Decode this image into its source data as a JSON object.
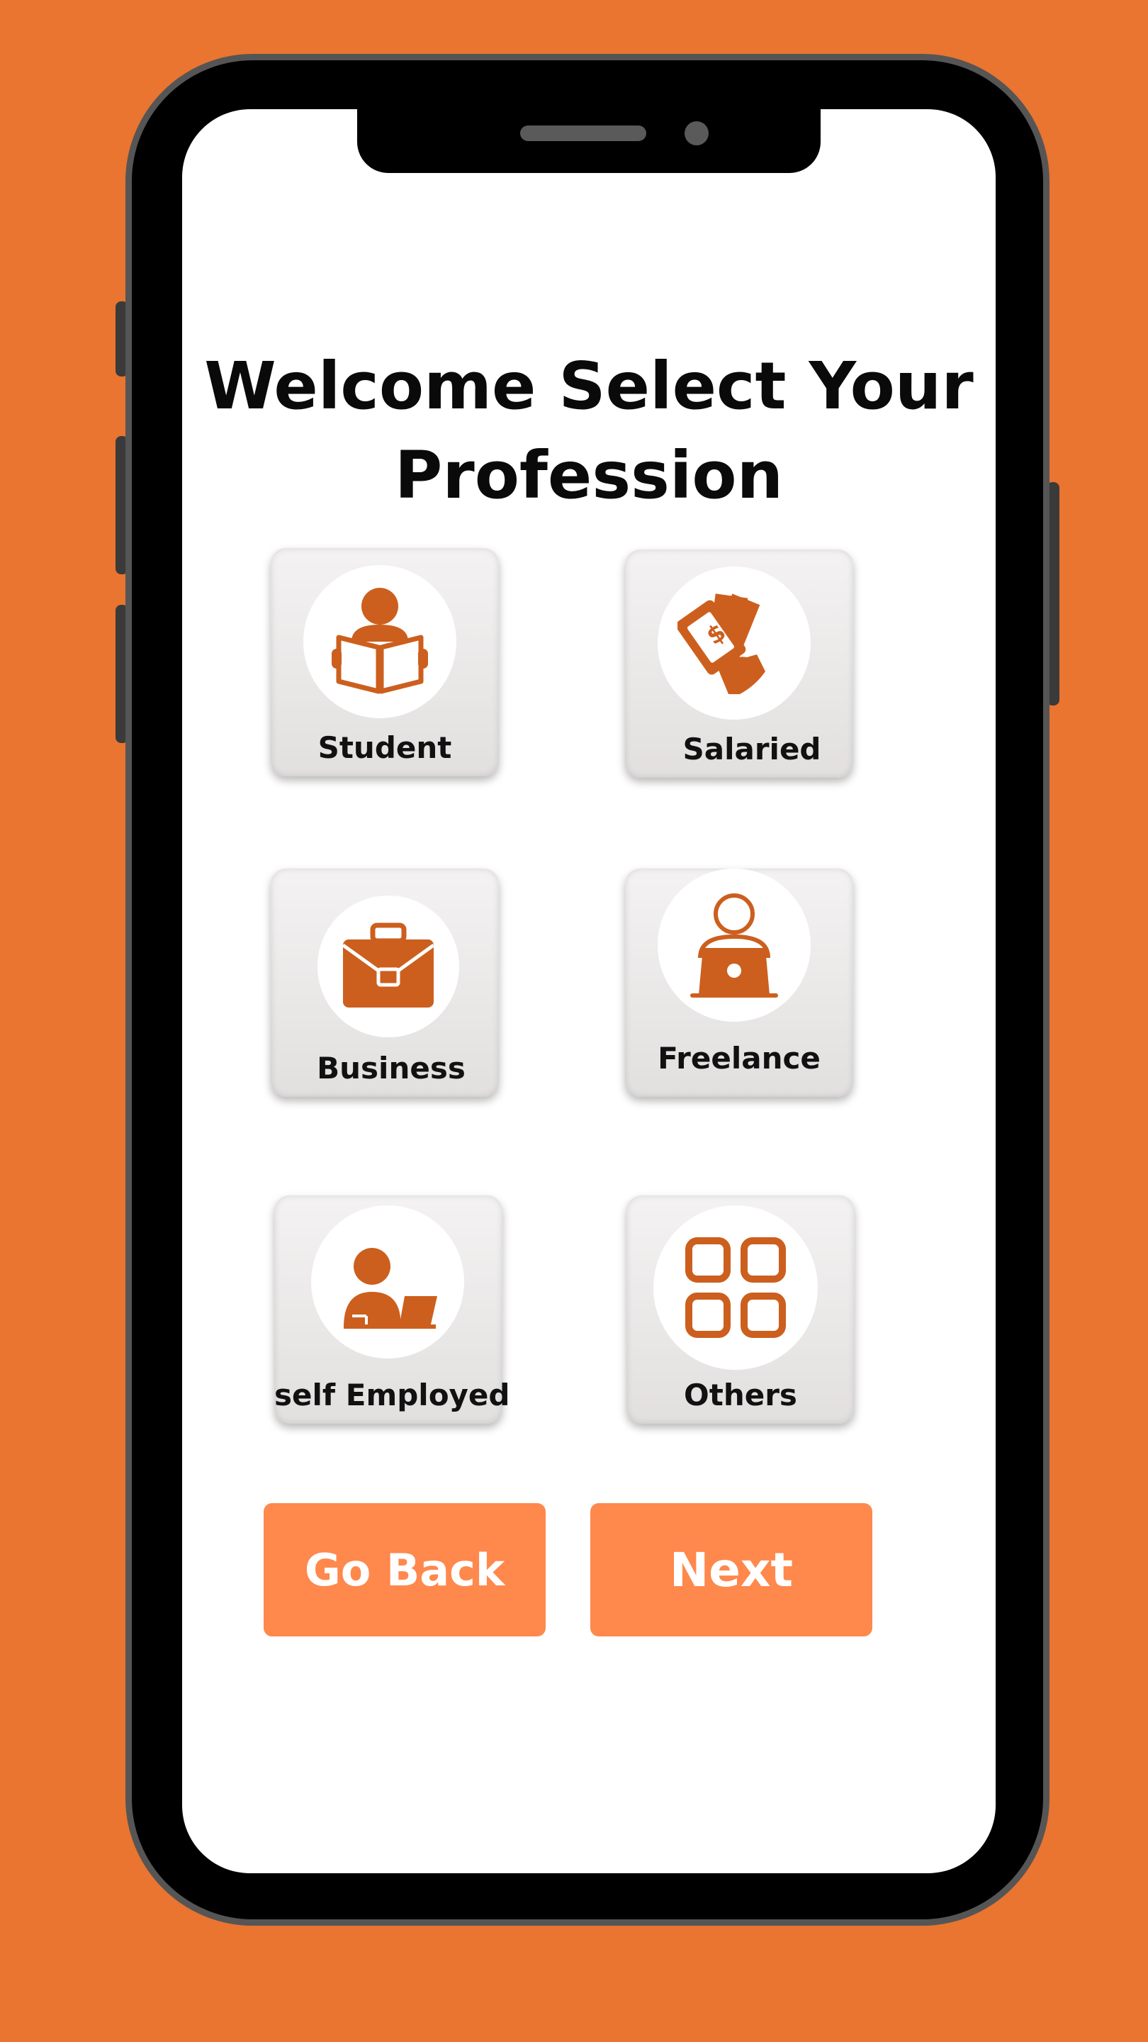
{
  "page": {
    "title_line1": "Welcome Select Your",
    "title_line2": "Profession"
  },
  "options": [
    {
      "label": "Student",
      "icon": "reading-person-icon"
    },
    {
      "label": "Salaried",
      "icon": "money-in-hand-icon"
    },
    {
      "label": "Business",
      "icon": "briefcase-icon"
    },
    {
      "label": "Freelance",
      "icon": "person-laptop-icon"
    },
    {
      "label": "self Employed",
      "icon": "person-at-desk-icon"
    },
    {
      "label": "Others",
      "icon": "grid-icon"
    }
  ],
  "actions": {
    "back_label": "Go Back",
    "next_label": "Next"
  },
  "colors": {
    "background": "#E97530",
    "icon": "#CC5F1E",
    "button": "#FF884D"
  }
}
